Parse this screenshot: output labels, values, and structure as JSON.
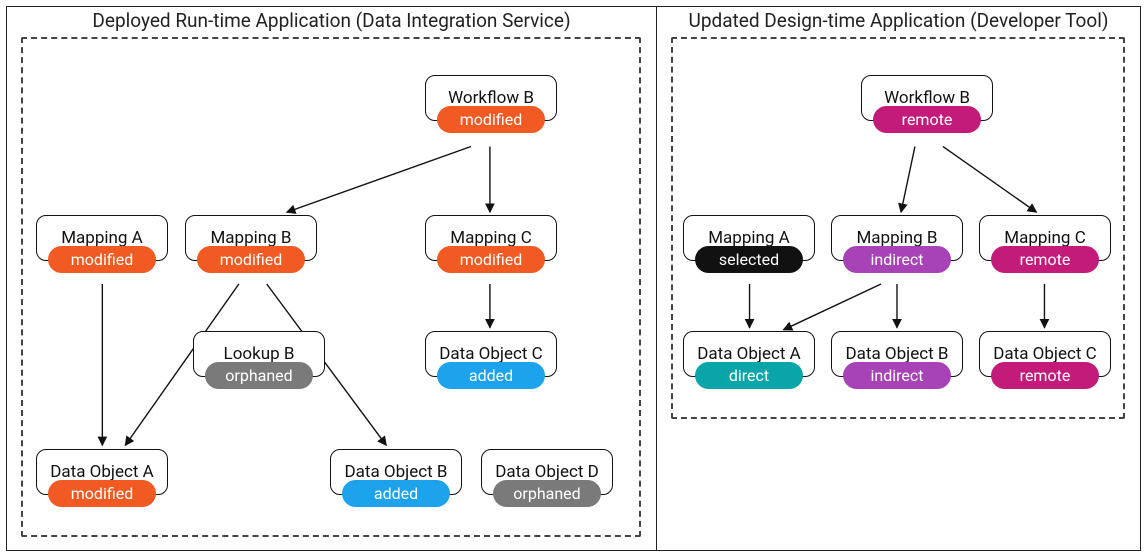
{
  "colors": {
    "orange": "#f15a22",
    "blue": "#1ca3ec",
    "gray": "#7a7a7a",
    "black": "#111111",
    "purple": "#a743b6",
    "magenta": "#c21b7a",
    "teal": "#0aa5a8"
  },
  "left": {
    "title": "Deployed Run-time Application (Data Integration Service)",
    "nodes": {
      "workflow_b": {
        "label": "Workflow B",
        "status": "modified",
        "color": "orange"
      },
      "mapping_a": {
        "label": "Mapping A",
        "status": "modified",
        "color": "orange"
      },
      "mapping_b": {
        "label": "Mapping B",
        "status": "modified",
        "color": "orange"
      },
      "mapping_c": {
        "label": "Mapping C",
        "status": "modified",
        "color": "orange"
      },
      "lookup_b": {
        "label": "Lookup B",
        "status": "orphaned",
        "color": "gray"
      },
      "data_object_a": {
        "label": "Data Object A",
        "status": "modified",
        "color": "orange"
      },
      "data_object_b": {
        "label": "Data Object B",
        "status": "added",
        "color": "blue"
      },
      "data_object_c": {
        "label": "Data Object C",
        "status": "added",
        "color": "blue"
      },
      "data_object_d": {
        "label": "Data Object D",
        "status": "orphaned",
        "color": "gray"
      }
    },
    "edges": [
      [
        "workflow_b",
        "mapping_b"
      ],
      [
        "workflow_b",
        "mapping_c"
      ],
      [
        "mapping_a",
        "data_object_a"
      ],
      [
        "mapping_b",
        "data_object_a"
      ],
      [
        "mapping_b",
        "data_object_b"
      ],
      [
        "mapping_c",
        "data_object_c"
      ]
    ]
  },
  "right": {
    "title": "Updated Design-time Application (Developer Tool)",
    "nodes": {
      "workflow_b": {
        "label": "Workflow B",
        "status": "remote",
        "color": "magenta"
      },
      "mapping_a": {
        "label": "Mapping A",
        "status": "selected",
        "color": "black"
      },
      "mapping_b": {
        "label": "Mapping B",
        "status": "indirect",
        "color": "purple"
      },
      "mapping_c": {
        "label": "Mapping C",
        "status": "remote",
        "color": "magenta"
      },
      "data_object_a": {
        "label": "Data Object A",
        "status": "direct",
        "color": "teal"
      },
      "data_object_b": {
        "label": "Data Object B",
        "status": "indirect",
        "color": "purple"
      },
      "data_object_c": {
        "label": "Data Object C",
        "status": "remote",
        "color": "magenta"
      }
    },
    "edges": [
      [
        "workflow_b",
        "mapping_b"
      ],
      [
        "workflow_b",
        "mapping_c"
      ],
      [
        "mapping_a",
        "data_object_a"
      ],
      [
        "mapping_b",
        "data_object_a"
      ],
      [
        "mapping_b",
        "data_object_b"
      ],
      [
        "mapping_c",
        "data_object_c"
      ]
    ]
  }
}
